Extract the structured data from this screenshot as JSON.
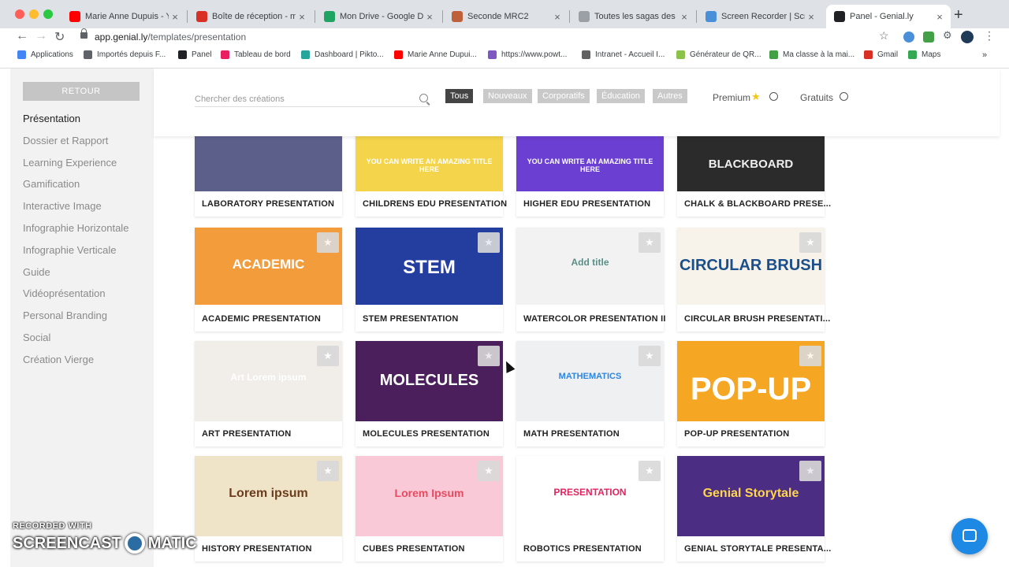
{
  "browser": {
    "tabs": [
      {
        "label": "Marie Anne Dupuis - YouTube",
        "color": "#ff0000"
      },
      {
        "label": "Boîte de réception - marie",
        "color": "#d93025"
      },
      {
        "label": "Mon Drive - Google Drive",
        "color": "#1fa463"
      },
      {
        "label": "Seconde MRC2",
        "color": "#c0603a"
      },
      {
        "label": "Toutes les sagas des gra",
        "color": "#9aa0a6"
      },
      {
        "label": "Screen Recorder | Screen",
        "color": "#4a90d9"
      },
      {
        "label": "Panel - Genial.ly",
        "color": "#202124"
      }
    ],
    "url_host": "app.genial.ly",
    "url_path": "/templates/presentation",
    "bookmarks": [
      {
        "label": "Applications",
        "color": "#4285f4"
      },
      {
        "label": "Importés depuis F...",
        "color": "#5f6368"
      },
      {
        "label": "Panel",
        "color": "#202124"
      },
      {
        "label": "Tableau de bord",
        "color": "#e91e63"
      },
      {
        "label": "Dashboard | Pikto...",
        "color": "#26a69a"
      },
      {
        "label": "Marie Anne Dupui...",
        "color": "#ff0000"
      },
      {
        "label": "https://www.powt...",
        "color": "#7e57c2"
      },
      {
        "label": "Intranet - Accueil I...",
        "color": "#616161"
      },
      {
        "label": "Générateur de QR...",
        "color": "#8bc34a"
      },
      {
        "label": "Ma classe à la mai...",
        "color": "#43a047"
      },
      {
        "label": "Gmail",
        "color": "#d93025"
      },
      {
        "label": "Maps",
        "color": "#34a853"
      }
    ]
  },
  "sidebar": {
    "back_label": "RETOUR",
    "categories": [
      "Présentation",
      "Dossier et Rapport",
      "Learning Experience",
      "Gamification",
      "Interactive Image",
      "Infographie Horizontale",
      "Infographie Verticale",
      "Guide",
      "Vidéoprésentation",
      "Personal Branding",
      "Social",
      "Création Vierge"
    ]
  },
  "filters": {
    "search_placeholder": "Chercher des créations",
    "chips": [
      "Tous",
      "Nouveaux",
      "Corporatifs",
      "Éducation",
      "Autres"
    ],
    "premium_label": "Premium",
    "free_label": "Gratuits"
  },
  "cards": [
    {
      "title": "LABORATORY PRESENTATION",
      "bg": "#5b5f8a"
    },
    {
      "title": "CHILDRENS EDU PRESENTATION",
      "bg": "#f3d44a",
      "thumb_text": "YOU CAN WRITE AN AMAZING TITLE HERE"
    },
    {
      "title": "HIGHER EDU PRESENTATION",
      "bg": "#6b3fd1",
      "thumb_text": "YOU CAN WRITE AN AMAZING TITLE HERE"
    },
    {
      "title": "CHALK & BLACKBOARD PRESE...",
      "bg": "#2b2b2b",
      "thumb_text": "BLACKBOARD"
    },
    {
      "title": "ACADEMIC PRESENTATION",
      "bg": "#f39c3c",
      "thumb_text": "ACADEMIC"
    },
    {
      "title": "STEM PRESENTATION",
      "bg": "#243ea0",
      "thumb_text": "STEM"
    },
    {
      "title": "WATERCOLOR PRESENTATION II",
      "bg": "#f2f2f2",
      "thumb_text": "Add title"
    },
    {
      "title": "CIRCULAR BRUSH PRESENTATI...",
      "bg": "#f7f2ea",
      "thumb_text": "CIRCULAR BRUSH"
    },
    {
      "title": "ART PRESENTATION",
      "bg": "#f1ede8",
      "thumb_text": "Art Lorem ipsum"
    },
    {
      "title": "MOLECULES PRESENTATION",
      "bg": "#4a1f5c",
      "thumb_text": "MOLECULES"
    },
    {
      "title": "MATH PRESENTATION",
      "bg": "#eef0f2",
      "thumb_text": "MATHEMATICS"
    },
    {
      "title": "POP-UP PRESENTATION",
      "bg": "#f5a623",
      "thumb_text": "POP-UP"
    },
    {
      "title": "HISTORY PRESENTATION",
      "bg": "#efe3c8",
      "thumb_text": "Lorem ipsum"
    },
    {
      "title": "CUBES PRESENTATION",
      "bg": "#f9c9d8",
      "thumb_text": "Lorem Ipsum"
    },
    {
      "title": "ROBOTICS PRESENTATION",
      "bg": "#ffffff",
      "thumb_text": "PRESENTATION"
    },
    {
      "title": "GENIAL STORYTALE PRESENTA...",
      "bg": "#4b2e83",
      "thumb_text": "Genial Storytale"
    }
  ],
  "watermark": {
    "recorded": "RECORDED WITH",
    "brand_left": "SCREENCAST",
    "brand_right": "MATIC"
  }
}
